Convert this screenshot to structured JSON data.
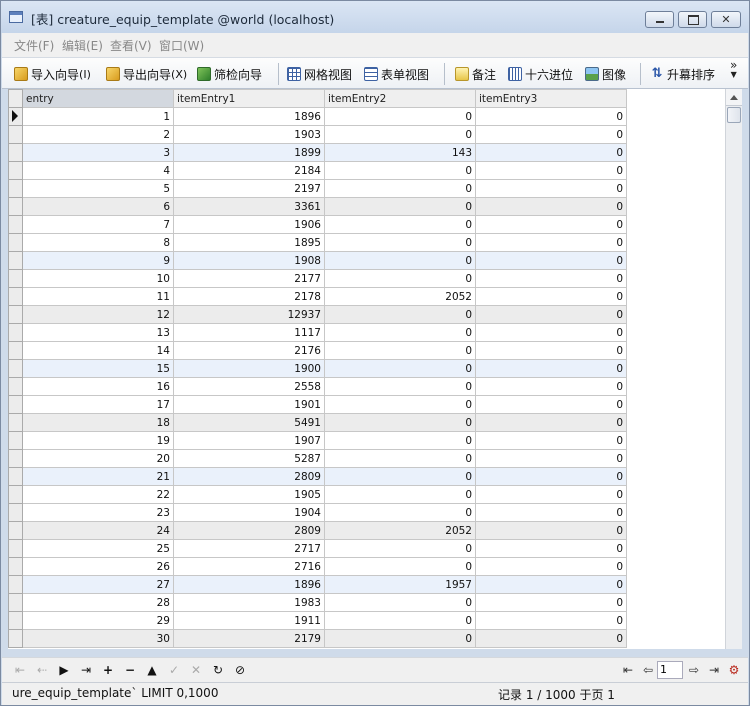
{
  "window": {
    "title": "[表] creature_equip_template @world (localhost)",
    "close_label": "✕"
  },
  "menu": [
    {
      "label": "文件(F)"
    },
    {
      "label": "编辑(E)"
    },
    {
      "label": "查看(V)"
    },
    {
      "label": "窗口(W)"
    }
  ],
  "toolbar": {
    "import": "导入向导",
    "import_key": "I",
    "export": "导出向导",
    "export_key": "X",
    "filter": "筛检向导",
    "grid_view": "网格视图",
    "form_view": "表单视图",
    "memo": "备注",
    "hex": "十六进位",
    "image": "图像",
    "sort": "升幕排序",
    "more": "»"
  },
  "table": {
    "columns": [
      "entry",
      "itemEntry1",
      "itemEntry2",
      "itemEntry3"
    ],
    "rows": [
      [
        "1",
        "1896",
        "0",
        "0"
      ],
      [
        "2",
        "1903",
        "0",
        "0"
      ],
      [
        "3",
        "1899",
        "143",
        "0"
      ],
      [
        "4",
        "2184",
        "0",
        "0"
      ],
      [
        "5",
        "2197",
        "0",
        "0"
      ],
      [
        "6",
        "3361",
        "0",
        "0"
      ],
      [
        "7",
        "1906",
        "0",
        "0"
      ],
      [
        "8",
        "1895",
        "0",
        "0"
      ],
      [
        "9",
        "1908",
        "0",
        "0"
      ],
      [
        "10",
        "2177",
        "0",
        "0"
      ],
      [
        "11",
        "2178",
        "2052",
        "0"
      ],
      [
        "12",
        "12937",
        "0",
        "0"
      ],
      [
        "13",
        "1117",
        "0",
        "0"
      ],
      [
        "14",
        "2176",
        "0",
        "0"
      ],
      [
        "15",
        "1900",
        "0",
        "0"
      ],
      [
        "16",
        "2558",
        "0",
        "0"
      ],
      [
        "17",
        "1901",
        "0",
        "0"
      ],
      [
        "18",
        "5491",
        "0",
        "0"
      ],
      [
        "19",
        "1907",
        "0",
        "0"
      ],
      [
        "20",
        "5287",
        "0",
        "0"
      ],
      [
        "21",
        "2809",
        "0",
        "0"
      ],
      [
        "22",
        "1905",
        "0",
        "0"
      ],
      [
        "23",
        "1904",
        "0",
        "0"
      ],
      [
        "24",
        "2809",
        "2052",
        "0"
      ],
      [
        "25",
        "2717",
        "0",
        "0"
      ],
      [
        "26",
        "2716",
        "0",
        "0"
      ],
      [
        "27",
        "1896",
        "1957",
        "0"
      ],
      [
        "28",
        "1983",
        "0",
        "0"
      ],
      [
        "29",
        "1911",
        "0",
        "0"
      ],
      [
        "30",
        "2179",
        "0",
        "0"
      ]
    ]
  },
  "nav": {
    "page": "1"
  },
  "status": {
    "sql": "ure_equip_template` LIMIT 0,1000",
    "records": "记录 1 / 1000 于页 1"
  }
}
